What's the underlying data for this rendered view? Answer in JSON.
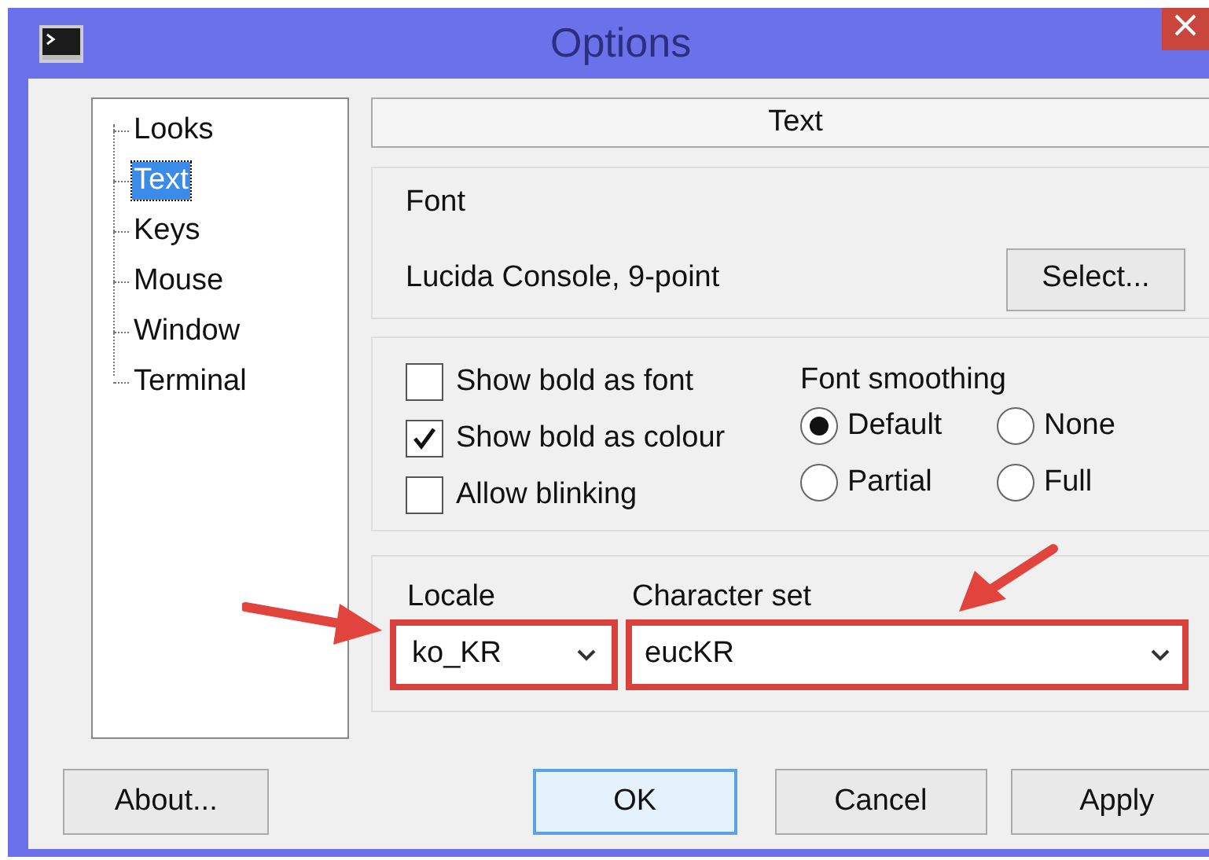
{
  "window": {
    "title": "Options"
  },
  "tree": {
    "items": [
      {
        "label": "Looks",
        "selected": false
      },
      {
        "label": "Text",
        "selected": true
      },
      {
        "label": "Keys",
        "selected": false
      },
      {
        "label": "Mouse",
        "selected": false
      },
      {
        "label": "Window",
        "selected": false
      },
      {
        "label": "Terminal",
        "selected": false
      }
    ]
  },
  "panel_title": "Text",
  "font_group": {
    "label": "Font",
    "value": "Lucida Console, 9-point",
    "button": "Select..."
  },
  "checkboxes": [
    {
      "label": "Show bold as font",
      "checked": false
    },
    {
      "label": "Show bold as colour",
      "checked": true
    },
    {
      "label": "Allow blinking",
      "checked": false
    }
  ],
  "font_smoothing": {
    "label": "Font smoothing",
    "options": [
      {
        "label": "Default",
        "selected": true
      },
      {
        "label": "None",
        "selected": false
      },
      {
        "label": "Partial",
        "selected": false
      },
      {
        "label": "Full",
        "selected": false
      }
    ]
  },
  "locale": {
    "label": "Locale",
    "value": "ko_KR",
    "highlighted": true
  },
  "character_set": {
    "label": "Character set",
    "value": "eucKR",
    "highlighted": true
  },
  "buttons": [
    {
      "label": "About...",
      "default": false
    },
    {
      "label": "OK",
      "default": true
    },
    {
      "label": "Cancel",
      "default": false
    },
    {
      "label": "Apply",
      "default": false
    }
  ]
}
